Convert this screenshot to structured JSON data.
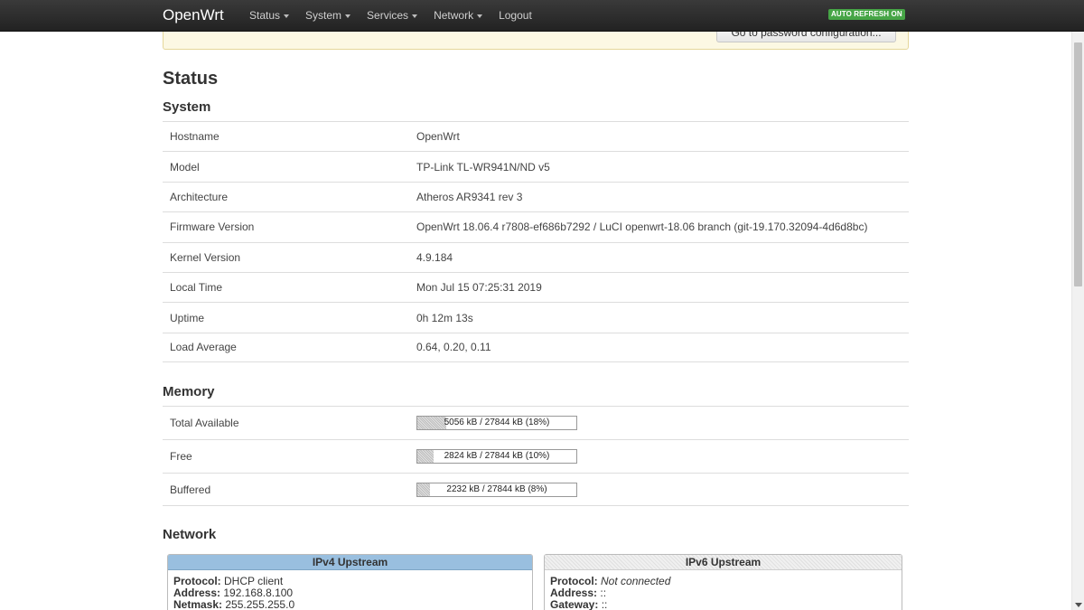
{
  "navbar": {
    "brand": "OpenWrt",
    "menu": [
      {
        "label": "Status",
        "has_dropdown": true
      },
      {
        "label": "System",
        "has_dropdown": true
      },
      {
        "label": "Services",
        "has_dropdown": true
      },
      {
        "label": "Network",
        "has_dropdown": true
      },
      {
        "label": "Logout",
        "has_dropdown": false
      }
    ],
    "auto_refresh": "AUTO REFRESH ON"
  },
  "alert": {
    "button_label": "Go to password configuration..."
  },
  "page": {
    "title": "Status"
  },
  "system": {
    "title": "System",
    "rows": [
      {
        "label": "Hostname",
        "value": "OpenWrt"
      },
      {
        "label": "Model",
        "value": "TP-Link TL-WR941N/ND v5"
      },
      {
        "label": "Architecture",
        "value": "Atheros AR9341 rev 3"
      },
      {
        "label": "Firmware Version",
        "value": "OpenWrt 18.06.4 r7808-ef686b7292 / LuCI openwrt-18.06 branch (git-19.170.32094-4d6d8bc)"
      },
      {
        "label": "Kernel Version",
        "value": "4.9.184"
      },
      {
        "label": "Local Time",
        "value": "Mon Jul 15 07:25:31 2019"
      },
      {
        "label": "Uptime",
        "value": "0h 12m 13s"
      },
      {
        "label": "Load Average",
        "value": "0.64, 0.20, 0.11"
      }
    ]
  },
  "memory": {
    "title": "Memory",
    "rows": [
      {
        "label": "Total Available",
        "text": "5056 kB / 27844 kB (18%)",
        "percent": 18
      },
      {
        "label": "Free",
        "text": "2824 kB / 27844 kB (10%)",
        "percent": 10
      },
      {
        "label": "Buffered",
        "text": "2232 kB / 27844 kB (8%)",
        "percent": 8
      }
    ]
  },
  "network": {
    "title": "Network",
    "ipv4": {
      "header": "IPv4 Upstream",
      "protocol_label": "Protocol:",
      "protocol_value": "DHCP client",
      "address_label": "Address:",
      "address_value": "192.168.8.100",
      "netmask_label": "Netmask:",
      "netmask_value": "255.255.255.0"
    },
    "ipv6": {
      "header": "IPv6 Upstream",
      "protocol_label": "Protocol:",
      "protocol_value": "Not connected",
      "address_label": "Address:",
      "address_value": "::",
      "gateway_label": "Gateway:",
      "gateway_value": "::"
    }
  },
  "colors": {
    "navbar_bg": "#222222",
    "auto_refresh_badge": "#46a546",
    "alert_bg": "#fcf8e3",
    "ipv4_header": "#99bfdf"
  }
}
